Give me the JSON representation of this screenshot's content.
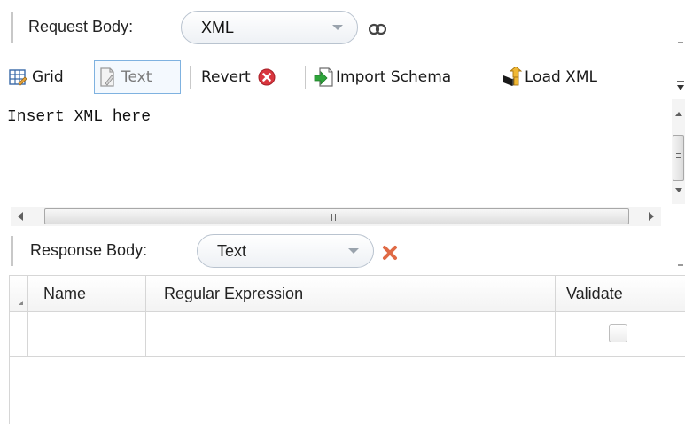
{
  "request": {
    "label": "Request Body:",
    "format_value": "XML",
    "link_icon": "link-icon"
  },
  "toolbar": {
    "grid_label": "Grid",
    "text_label": "Text",
    "revert_label": "Revert",
    "import_label": "Import Schema",
    "load_label": "Load XML",
    "icons": {
      "grid": "grid-table-icon",
      "text": "text-document-icon",
      "revert": "red-x-circle-icon",
      "import": "green-import-arrow-icon",
      "load": "load-upload-icon"
    }
  },
  "editor": {
    "content": "Insert XML here"
  },
  "response": {
    "label": "Response Body:",
    "format_value": "Text",
    "clear_icon": "clear-x-icon"
  },
  "table": {
    "columns": [
      "Name",
      "Regular Expression",
      "Validate"
    ],
    "rows": [
      {
        "name": "",
        "regex": "",
        "validate": false
      }
    ]
  },
  "colors": {
    "accent_border": "#7fb2e0",
    "revert_red": "#d9363e",
    "clear_orange": "#e06a45",
    "import_green": "#2ea43a",
    "grid_line": "#d6d6d6"
  }
}
